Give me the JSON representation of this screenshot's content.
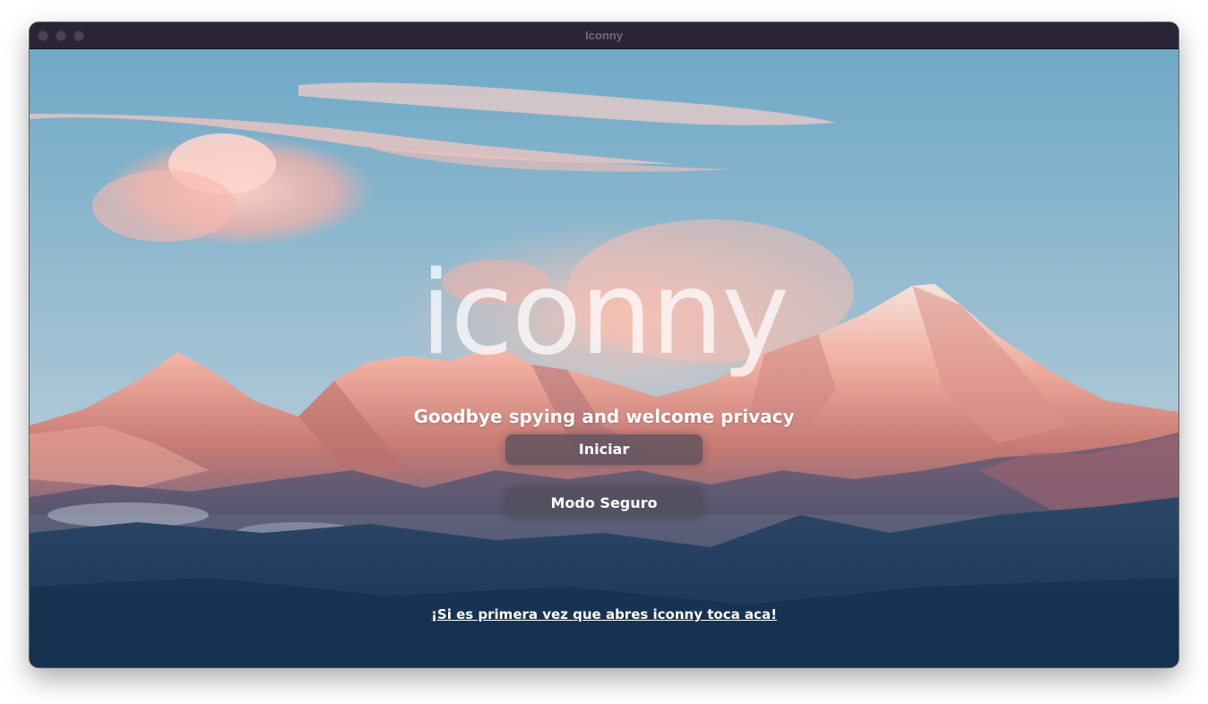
{
  "window": {
    "title": "Iconny"
  },
  "main": {
    "logo": "iconny",
    "tagline": "Goodbye spying and welcome privacy",
    "start_button": "Iniciar",
    "safe_mode_button": "Modo Seguro",
    "first_time_link": "¡Si es primera vez que abres iconny toca aca!"
  },
  "colors": {
    "titlebar": "#2a2536",
    "sky_top": "#6fa9c6",
    "sky_bottom": "#b8cdd9",
    "peak_light": "#f4b6a6",
    "valley_dark": "#1d3a5c",
    "button_bg": "#504e5c"
  },
  "icons": {
    "close": "traffic-light-close-icon",
    "minimize": "traffic-light-minimize-icon",
    "maximize": "traffic-light-maximize-icon"
  }
}
